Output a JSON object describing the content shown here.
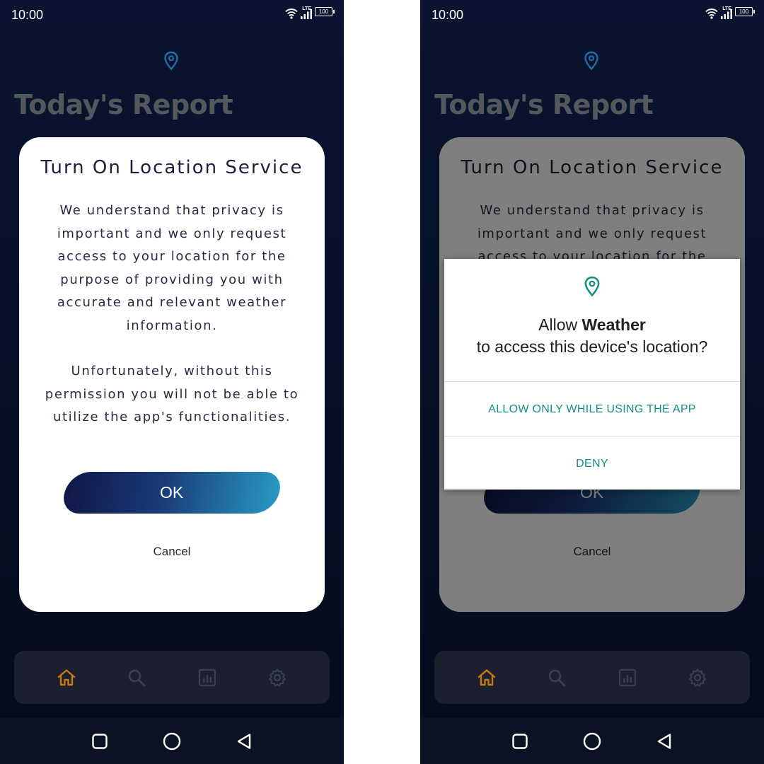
{
  "status_bar": {
    "time": "10:00",
    "network": "LTE",
    "battery": "100"
  },
  "header": {
    "title": "Today's Report",
    "location_icon": "map-pin-icon"
  },
  "location_dialog": {
    "title": "Turn On Location Service",
    "paragraph_1": "We understand that privacy is important and we only request access to your location for the purpose of providing you with accurate and relevant weather information.",
    "paragraph_2": "Unfortunately, without this permission you will not be able to utilize the app's functionalities.",
    "ok_label": "OK",
    "cancel_label": "Cancel"
  },
  "permission_dialog": {
    "prefix": "Allow ",
    "app_name": "Weather",
    "suffix": " to access this device's location?",
    "allow_label": "ALLOW ONLY WHILE USING THE APP",
    "deny_label": "DENY",
    "accent_color": "#12907f"
  },
  "bottom_nav": {
    "items": [
      {
        "icon": "home-icon",
        "active": true
      },
      {
        "icon": "search-icon",
        "active": false
      },
      {
        "icon": "chart-icon",
        "active": false
      },
      {
        "icon": "gear-icon",
        "active": false
      }
    ],
    "active_color": "#c77a10",
    "inactive_color": "#3b3f52"
  },
  "system_nav": {
    "buttons": [
      "recents-icon",
      "home-circle-icon",
      "back-icon"
    ]
  }
}
